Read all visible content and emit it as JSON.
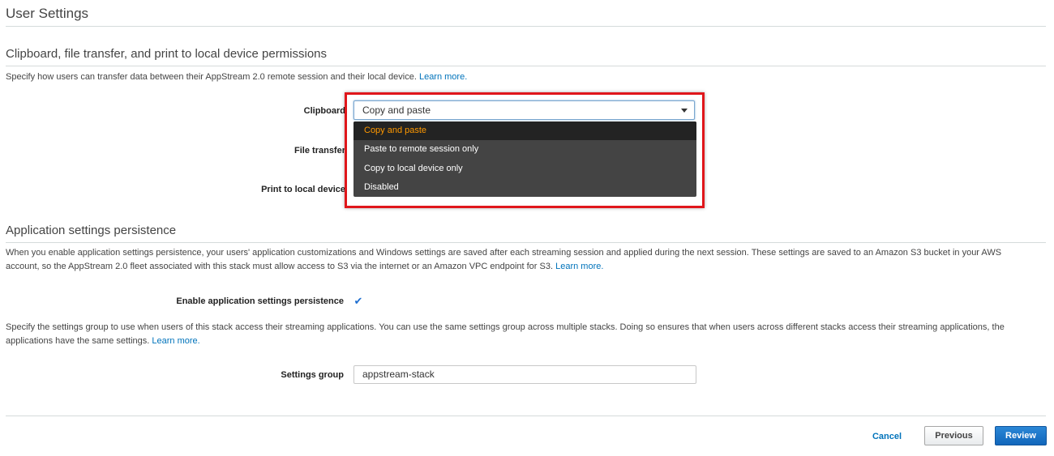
{
  "page": {
    "title": "User Settings"
  },
  "clipboard_section": {
    "title": "Clipboard, file transfer, and print to local device permissions",
    "description": "Specify how users can transfer data between their AppStream 2.0 remote session and their local device.",
    "learn_more": "Learn more.",
    "clipboard": {
      "label": "Clipboard",
      "selected": "Copy and paste",
      "options": [
        "Copy and paste",
        "Paste to remote session only",
        "Copy to local device only",
        "Disabled"
      ]
    },
    "file_transfer": {
      "label": "File transfer"
    },
    "print": {
      "label": "Print to local device"
    }
  },
  "persistence_section": {
    "title": "Application settings persistence",
    "description_line1": "When you enable application settings persistence, your users' application customizations and Windows settings are saved after each streaming session and applied during the next session. These settings are saved to an Amazon S3 bucket in your AWS",
    "description_line2": "account, so the AppStream 2.0 fleet associated with this stack must allow access to S3 via the internet or an Amazon VPC endpoint for S3.",
    "learn_more": "Learn more.",
    "enable_label": "Enable application settings persistence",
    "enable_checked_glyph": "✔",
    "group_description_line1": "Specify the settings group to use when users of this stack access their streaming applications. You can use the same settings group across multiple stacks. Doing so ensures that when users across different stacks access their streaming applications, the",
    "group_description_line2": "applications have the same settings.",
    "group_learn_more": "Learn more.",
    "settings_group_label": "Settings group",
    "settings_group_value": "appstream-stack"
  },
  "footer": {
    "cancel": "Cancel",
    "previous": "Previous",
    "review": "Review"
  },
  "colors": {
    "accent": "#0073bb",
    "selected_option": "#ff9900",
    "highlight_border": "#e0161b"
  }
}
